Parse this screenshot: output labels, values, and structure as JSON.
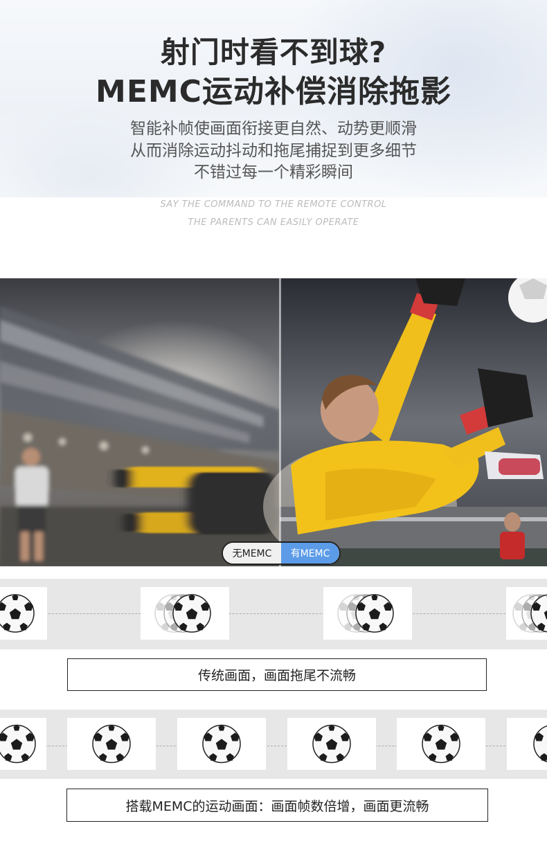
{
  "header": {
    "title_line_1": "射门时看不到球?",
    "title_line_2": "MEMC运动补偿消除拖影",
    "subtitle_lines": [
      "智能补帧使画面衔接更自然、动势更顺滑",
      "从而消除运动抖动和拖尾捕捉到更多细节",
      "不错过每一个精彩瞬间"
    ],
    "english_lines": [
      "SAY THE COMMAND TO THE REMOTE CONTROL",
      "THE PARENTS CAN EASILY OPERATE"
    ]
  },
  "comparison": {
    "toggle_off_label": "无MEMC",
    "toggle_on_label": "有MEMC",
    "accent_color": "#5b9be8"
  },
  "traditional": {
    "caption": "传统画面，画面拖尾不流畅"
  },
  "memc": {
    "caption": "搭载MEMC的运动画面：画面帧数倍增，画面更流畅"
  },
  "icons": {
    "ball": "soccer-ball-icon"
  }
}
